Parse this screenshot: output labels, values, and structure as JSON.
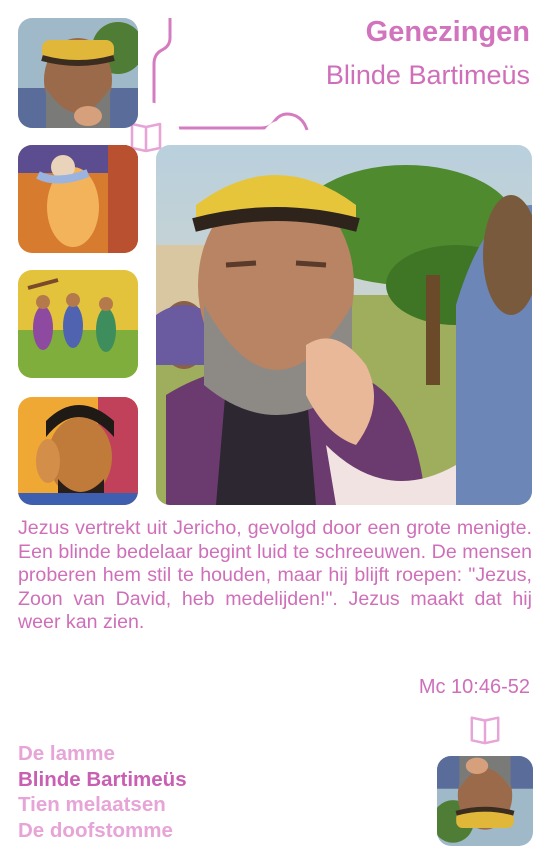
{
  "header": {
    "title": "Genezingen",
    "subtitle": "Blinde Bartimeüs"
  },
  "description": "Jezus vertrekt uit Jericho, gevolgd door een grote menigte. Een blinde bedelaar begint luid te schreeuwen. De mensen proberen hem stil te houden, maar hij blijft roepen: \"Jezus, Zoon van David, heb medelijden!\". Jezus maakt dat hij weer kan zien.",
  "reference": "Mc 10:46-52",
  "menu": {
    "items": [
      {
        "label": "De lamme",
        "active": false
      },
      {
        "label": "Blinde Bartimeüs",
        "active": true
      },
      {
        "label": "Tien melaatsen",
        "active": false
      },
      {
        "label": "De doofstomme",
        "active": false
      }
    ]
  },
  "icons": {
    "top": "open-book-icon",
    "bottom": "open-book-icon"
  },
  "colors": {
    "accent": "#cf6fb9",
    "accent_light": "#e6a4d7",
    "accent_active": "#c95fb2"
  }
}
